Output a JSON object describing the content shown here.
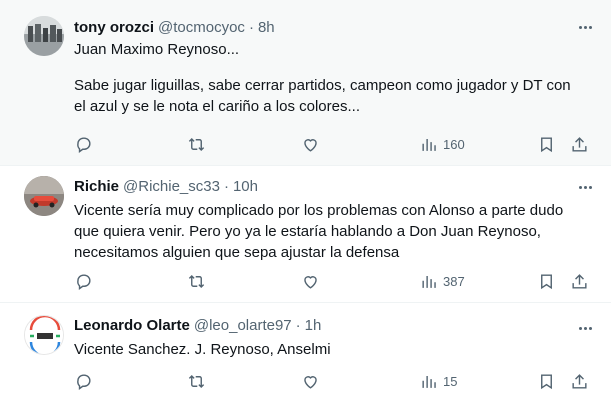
{
  "tweets": [
    {
      "name": "tony orozci",
      "handle": "@tocmocyoc",
      "sep": "·",
      "time": "8h",
      "lines": [
        "Juan Maximo Reynoso...",
        "",
        "Sabe jugar liguillas, sabe cerrar partidos, campeon como jugador y DT con",
        "el azul y se le nota el cariño a los colores..."
      ],
      "views": "160"
    },
    {
      "name": "Richie",
      "handle": "@Richie_sc33",
      "sep": "·",
      "time": "10h",
      "lines": [
        "Vicente sería muy complicado por los problemas con Alonso a parte dudo",
        "que quiera venir. Pero yo ya le estaría hablando a Don Juan Reynoso,",
        "necesitamos alguien que sepa ajustar la defensa"
      ],
      "views": "387"
    },
    {
      "name": "Leonardo Olarte",
      "handle": "@leo_olarte97",
      "sep": "·",
      "time": "1h",
      "lines": [
        "Vicente Sanchez. J. Reynoso, Anselmi"
      ],
      "views": "15"
    }
  ],
  "colors": {
    "text": "#0f1419",
    "secondary": "#536471",
    "highlight_bg": "#f7f9f9",
    "divider": "#eff3f4"
  },
  "icons": [
    "reply-icon",
    "retweet-icon",
    "like-icon",
    "views-icon",
    "bookmark-icon",
    "share-icon",
    "more-icon"
  ]
}
